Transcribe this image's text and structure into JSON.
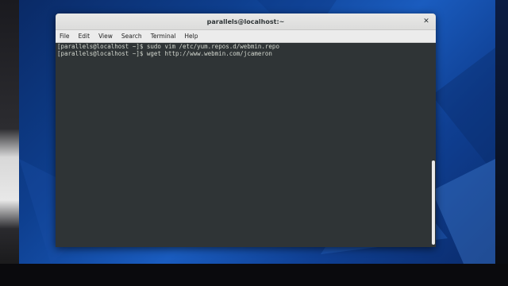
{
  "window": {
    "title": "parallels@localhost:~",
    "close_glyph": "✕"
  },
  "menubar": {
    "items": [
      {
        "label": "File"
      },
      {
        "label": "Edit"
      },
      {
        "label": "View"
      },
      {
        "label": "Search"
      },
      {
        "label": "Terminal"
      },
      {
        "label": "Help"
      }
    ]
  },
  "terminal": {
    "lines": [
      "[parallels@localhost ~]$ sudo vim /etc/yum.repos.d/webmin.repo",
      "[parallels@localhost ~]$ wget http://www.webmin.com/jcameron"
    ]
  },
  "colors": {
    "terminal_bg": "#2f3436",
    "terminal_fg": "#d3d7cf",
    "desktop_blue": "#1a5cbf"
  }
}
